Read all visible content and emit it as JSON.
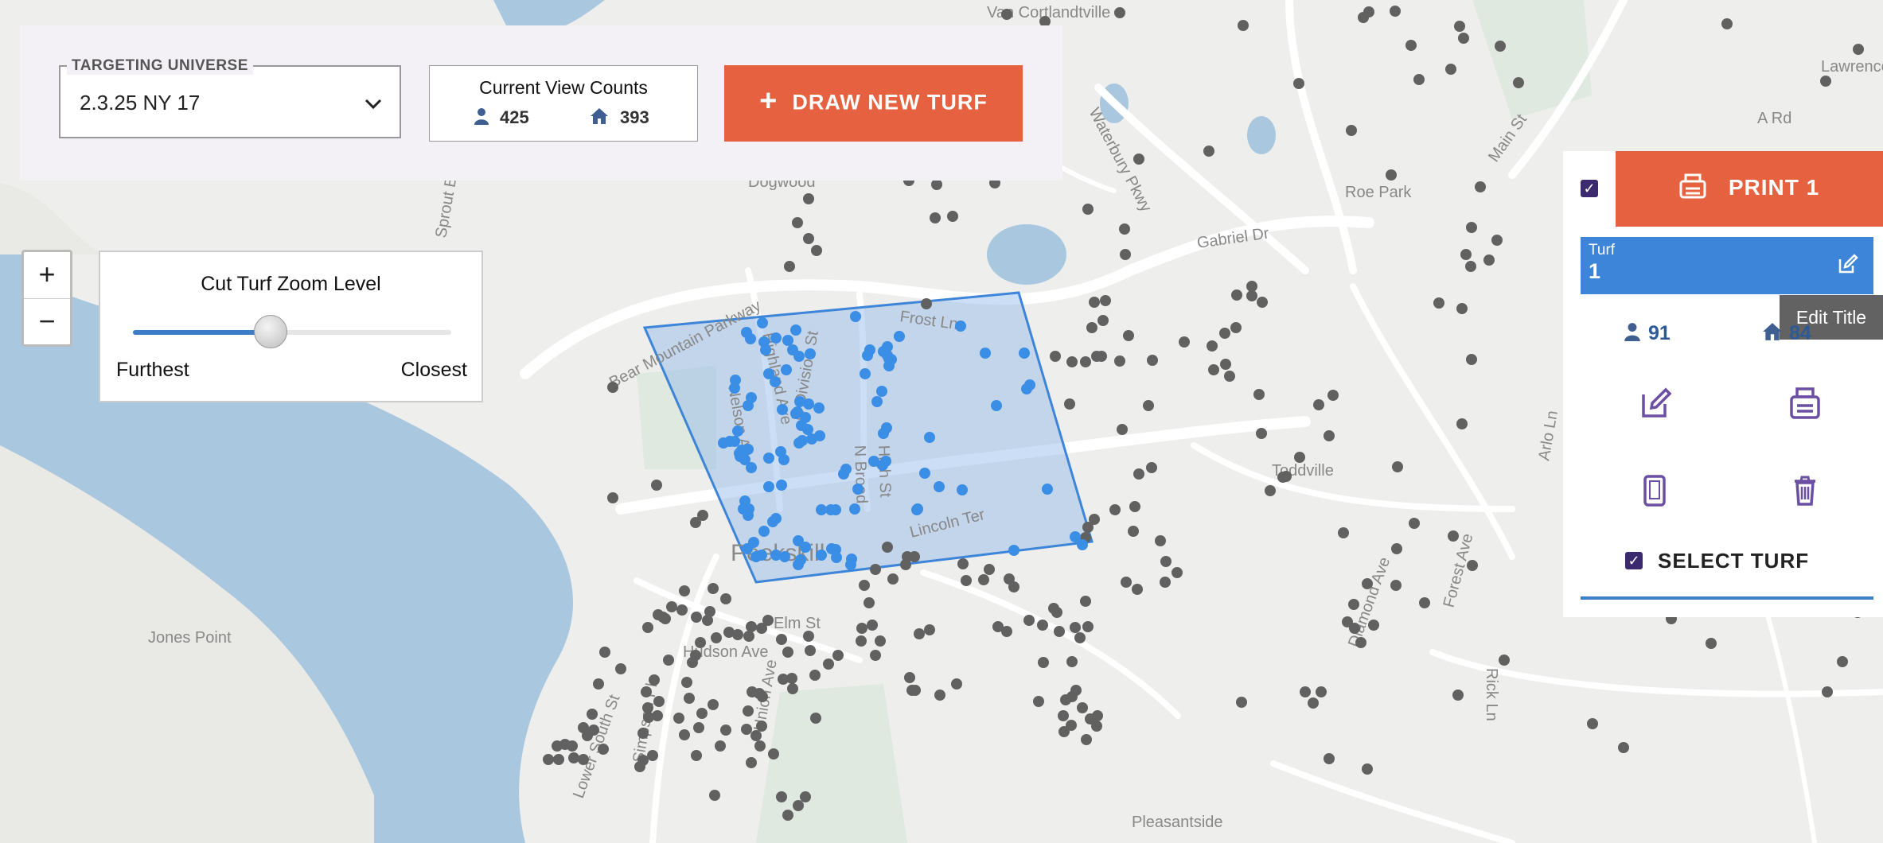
{
  "toolbar": {
    "universe_label": "TARGETING UNIVERSE",
    "universe_value": "2.3.25 NY 17",
    "counts_title": "Current View Counts",
    "people_count": "425",
    "household_count": "393",
    "draw_label": "DRAW NEW TURF"
  },
  "zoom": {
    "in_label": "+",
    "out_label": "−",
    "panel_title": "Cut Turf Zoom Level",
    "min_label": "Furthest",
    "max_label": "Closest",
    "slider_level": 0.43
  },
  "turf_panel": {
    "print_label": "PRINT 1",
    "turf_label": "Turf",
    "turf_number": "1",
    "tooltip": "Edit Title",
    "people_count": "91",
    "household_count": "84",
    "select_label": "SELECT TURF"
  },
  "map_labels": [
    "Van Cortlandtville",
    "Roe Park",
    "Gabriel Dr",
    "Waterbury Pkwy",
    "Main St",
    "A Rd",
    "Lawrence F",
    "Bear Mountain Parkway",
    "Frost Ln",
    "Highland Ave",
    "N Division St",
    "Nelson Ave",
    "N Broad",
    "High St",
    "Lincoln Ter",
    "Peekskill",
    "Hudson Ave",
    "Elm St",
    "Union Ave",
    "Lower South St",
    "Simpson Pl",
    "Jones Point",
    "Toddville",
    "Arlo Ln",
    "Diamond Ave",
    "Forest Ave",
    "Rick Ln",
    "Pleasantside",
    "Sprout Brook Rd",
    "Dogwood"
  ],
  "colors": {
    "accent": "#e5613f",
    "turf_blue": "#3d85d8",
    "panel_bg": "#f3f1f6",
    "point_gray": "#616161",
    "point_blue": "#3a8ee6",
    "water": "#a9c7de",
    "icon_purple": "#6b4fa3"
  },
  "icons": [
    "person-icon",
    "home-icon",
    "plus-icon",
    "printer-icon",
    "edit-icon",
    "mobile-icon",
    "trash-icon",
    "checkbox-icon",
    "chevron-down-icon"
  ]
}
